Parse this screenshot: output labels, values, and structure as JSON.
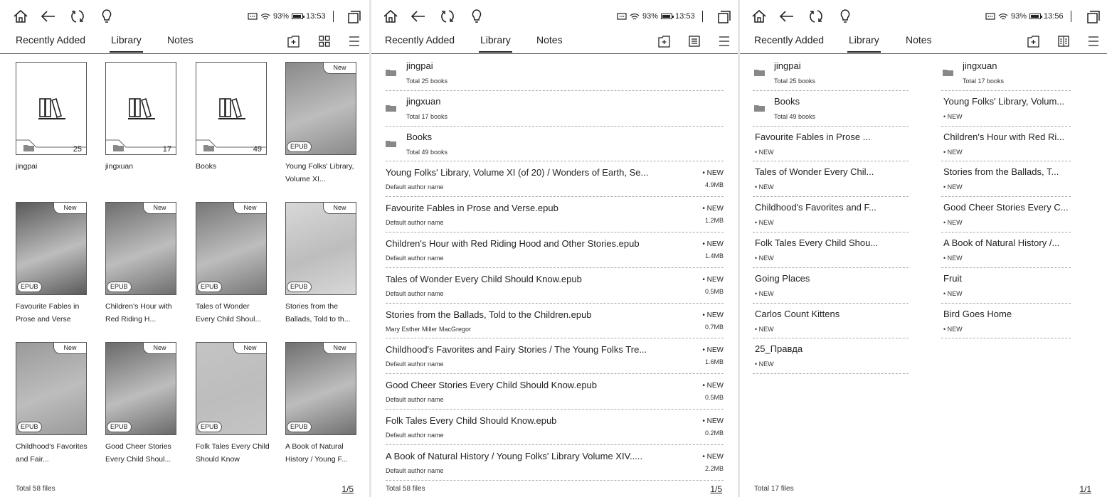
{
  "status_bar": [
    {
      "battery": "93%",
      "time": "13:53"
    },
    {
      "battery": "93%",
      "time": "13:53"
    },
    {
      "battery": "93%",
      "time": "13:56"
    }
  ],
  "tabs": {
    "recent": "Recently Added",
    "library": "Library",
    "notes": "Notes"
  },
  "panel1": {
    "folders": [
      {
        "name": "jingpai",
        "count": "25"
      },
      {
        "name": "jingxuan",
        "count": "17"
      },
      {
        "name": "Books",
        "count": "49"
      }
    ],
    "books": [
      {
        "title": "Young Folks' Library, Volume XI...",
        "badge": "New",
        "format": "EPUB",
        "color": "#8a8a8a"
      },
      {
        "title": "Favourite Fables in Prose and Verse",
        "badge": "New",
        "format": "EPUB",
        "color": "#5a5a5a"
      },
      {
        "title": "Children's Hour with Red Riding H...",
        "badge": "New",
        "format": "EPUB",
        "color": "#6e6e6e"
      },
      {
        "title": "Tales of Wonder Every Child Shoul...",
        "badge": "New",
        "format": "EPUB",
        "color": "#777777"
      },
      {
        "title": "Stories from the Ballads, Told to th...",
        "badge": "New",
        "format": "EPUB",
        "color": "#d8d8d8"
      },
      {
        "title": "Childhood's Favorites and Fair...",
        "badge": "New",
        "format": "EPUB",
        "color": "#9a9a9a"
      },
      {
        "title": "Good Cheer Stories Every Child Shoul...",
        "badge": "New",
        "format": "EPUB",
        "color": "#6a6a6a"
      },
      {
        "title": "Folk Tales Every Child Should Know",
        "badge": "New",
        "format": "EPUB",
        "color": "#c4c4c4"
      },
      {
        "title": "A Book of Natural History / Young F...",
        "badge": "New",
        "format": "EPUB",
        "color": "#707070"
      }
    ],
    "footer": "Total 58 files",
    "pager": "1/5"
  },
  "panel2": {
    "folders": [
      {
        "name": "jingpai",
        "sub": "Total 25 books"
      },
      {
        "name": "jingxuan",
        "sub": "Total 17 books"
      },
      {
        "name": "Books",
        "sub": "Total 49 books"
      }
    ],
    "books": [
      {
        "title": "Young Folks' Library, Volume XI (of 20) / Wonders of Earth, Se...",
        "author": "Default author name",
        "badge": "• NEW",
        "size": "4.9MB"
      },
      {
        "title": "Favourite Fables in Prose and Verse.epub",
        "author": "Default author name",
        "badge": "• NEW",
        "size": "1.2MB"
      },
      {
        "title": "Children's Hour with Red Riding Hood and Other Stories.epub",
        "author": "Default author name",
        "badge": "• NEW",
        "size": "1.4MB"
      },
      {
        "title": "Tales of Wonder Every Child Should Know.epub",
        "author": "Default author name",
        "badge": "• NEW",
        "size": "0.5MB"
      },
      {
        "title": "Stories from the Ballads, Told to the Children.epub",
        "author": "Mary Esther Miller MacGregor",
        "badge": "• NEW",
        "size": "0.7MB"
      },
      {
        "title": "Childhood's Favorites and Fairy Stories / The Young Folks Tre...",
        "author": "Default author name",
        "badge": "• NEW",
        "size": "1.6MB"
      },
      {
        "title": "Good Cheer Stories Every Child Should Know.epub",
        "author": "Default author name",
        "badge": "• NEW",
        "size": "0.5MB"
      },
      {
        "title": "Folk Tales Every Child Should Know.epub",
        "author": "Default author name",
        "badge": "• NEW",
        "size": "0.2MB"
      },
      {
        "title": "A Book of Natural History / Young Folks' Library Volume XIV.....",
        "author": "Default author name",
        "badge": "• NEW",
        "size": "2.2MB"
      }
    ],
    "footer": "Total 58 files",
    "pager": "1/5"
  },
  "panel3": {
    "left": [
      {
        "kind": "folder",
        "title": "jingpai",
        "sub": "Total 25 books"
      },
      {
        "kind": "folder",
        "title": "Books",
        "sub": "Total 49 books"
      },
      {
        "kind": "book",
        "title": "Favourite Fables in Prose ...",
        "sub": "• NEW"
      },
      {
        "kind": "book",
        "title": "Tales of Wonder Every Chil...",
        "sub": "• NEW"
      },
      {
        "kind": "book",
        "title": "Childhood's Favorites and F...",
        "sub": "• NEW"
      },
      {
        "kind": "book",
        "title": "Folk Tales Every Child Shou...",
        "sub": "• NEW"
      },
      {
        "kind": "book",
        "title": "Going Places",
        "sub": "• NEW"
      },
      {
        "kind": "book",
        "title": "Carlos Count Kittens",
        "sub": "• NEW"
      },
      {
        "kind": "book",
        "title": "25_Правда",
        "sub": "• NEW"
      }
    ],
    "right": [
      {
        "kind": "folder",
        "title": "jingxuan",
        "sub": "Total 17 books"
      },
      {
        "kind": "book",
        "title": "Young Folks' Library, Volum...",
        "sub": "• NEW"
      },
      {
        "kind": "book",
        "title": "Children's Hour with Red Ri...",
        "sub": "• NEW"
      },
      {
        "kind": "book",
        "title": "Stories from the Ballads, T...",
        "sub": "• NEW"
      },
      {
        "kind": "book",
        "title": "Good Cheer Stories Every C...",
        "sub": "• NEW"
      },
      {
        "kind": "book",
        "title": "A Book of Natural History /...",
        "sub": "• NEW"
      },
      {
        "kind": "book",
        "title": "Fruit",
        "sub": "• NEW"
      },
      {
        "kind": "book",
        "title": "Bird Goes Home",
        "sub": "• NEW"
      }
    ],
    "footer": "Total 17 files",
    "pager": "1/1"
  }
}
